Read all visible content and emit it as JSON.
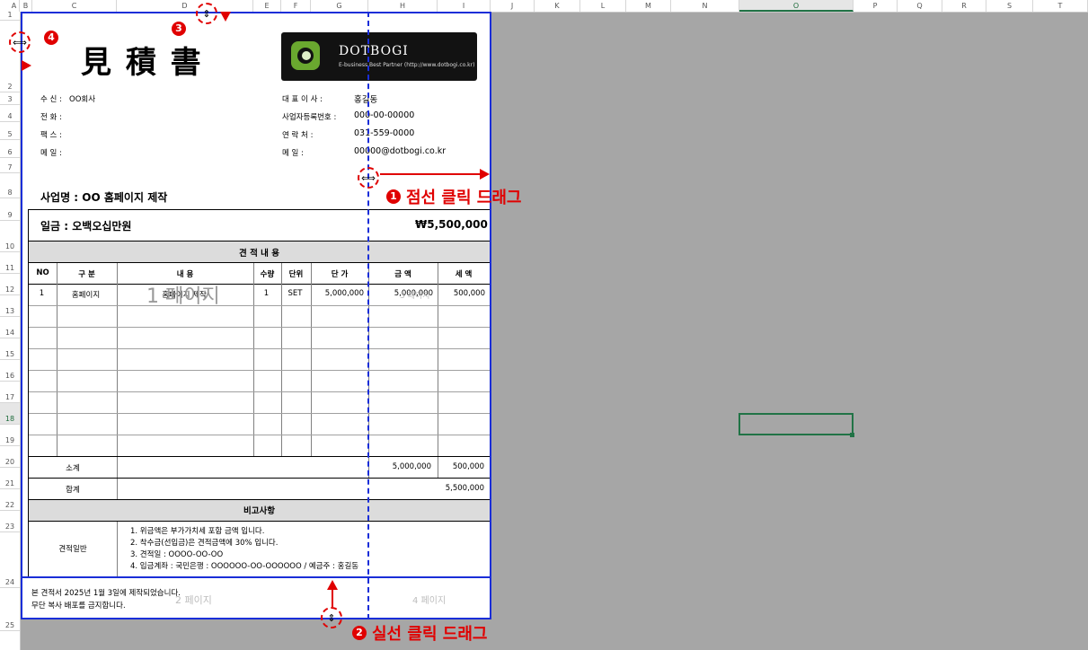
{
  "column_headers": [
    "A",
    "B",
    "C",
    "D",
    "E",
    "F",
    "G",
    "H",
    "I",
    "J",
    "K",
    "L",
    "M",
    "N",
    "O",
    "P",
    "Q",
    "R",
    "S",
    "T"
  ],
  "row_headers": [
    "1",
    "2",
    "3",
    "4",
    "5",
    "6",
    "7",
    "8",
    "9",
    "10",
    "11",
    "12",
    "13",
    "14",
    "15",
    "16",
    "17",
    "18",
    "19",
    "20",
    "21",
    "22",
    "23",
    "24",
    "25"
  ],
  "selected_column": "O",
  "selected_row": "18",
  "doc": {
    "title": "見 積 書",
    "logo_name": "DOTBOGI",
    "logo_tagline": "E-business Best Partner (http://www.dotbogi.co.kr)",
    "recipient": [
      {
        "label": "수  신 :",
        "value": "OO회사"
      },
      {
        "label": "전  화 :",
        "value": ""
      },
      {
        "label": "팩  스 :",
        "value": ""
      },
      {
        "label": "메  일 :",
        "value": ""
      }
    ],
    "issuer": [
      {
        "label": "대  표  이  사 :",
        "value": "홍길동"
      },
      {
        "label": "사업자등록번호 :",
        "value": "000-00-00000"
      },
      {
        "label": "연        락       처 :",
        "value": "031-559-0000"
      },
      {
        "label": "메                 일 :",
        "value": "00000@dotbogi.co.kr"
      }
    ],
    "project": "사업명 : OO 홈페이지 제작",
    "total_words": "일금 : 오백오십만원",
    "total_amount": "₩5,500,000",
    "section_title": "견 적 내 용",
    "columns": [
      "NO",
      "구    분",
      "내              용",
      "수량",
      "단위",
      "단 가",
      "금 액",
      "세 액"
    ],
    "rows": [
      {
        "no": "1",
        "category": "홈페이지",
        "content": "홈페이지 제작",
        "qty": "1",
        "unit": "SET",
        "unit_price": "5,000,000",
        "amount": "5,000,000",
        "tax": "500,000"
      }
    ],
    "subtotal_label": "소계",
    "subtotal_amount": "5,000,000",
    "subtotal_tax": "500,000",
    "total_label": "합계",
    "grand_total": "5,500,000",
    "remarks_title": "비고사항",
    "remarks_label": "견적일반",
    "remarks": [
      "1. 위금액은 부가가치세 포함 금액 입니다.",
      "2. 착수금(선입금)은 견적금액에 30% 입니다.",
      "3. 견적일 : OOOO-OO-OO",
      "4. 입금계좌 : 국민은행 : OOOOOO-OO-OOOOOO  / 예금주 : 홍길동"
    ],
    "footer_line1": "본 견적서 2025년 1월  3일에 제작되었습니다.",
    "footer_line2": "무단 복사 배포를 금지합니다."
  },
  "page_labels": {
    "p1": "1 페이지",
    "p2": "2 페이지",
    "p3": "3 페이지",
    "p4": "4 페이지"
  },
  "annotations": {
    "step1_badge": "1",
    "step1_text": "점선 클릭 드래그",
    "step2_badge": "2",
    "step2_text": "실선 클릭 드래그",
    "step3_badge": "3",
    "step4_badge": "4"
  },
  "colors": {
    "page_break": "#1a2ed8",
    "annotation": "#e00000",
    "selection": "#217346"
  }
}
